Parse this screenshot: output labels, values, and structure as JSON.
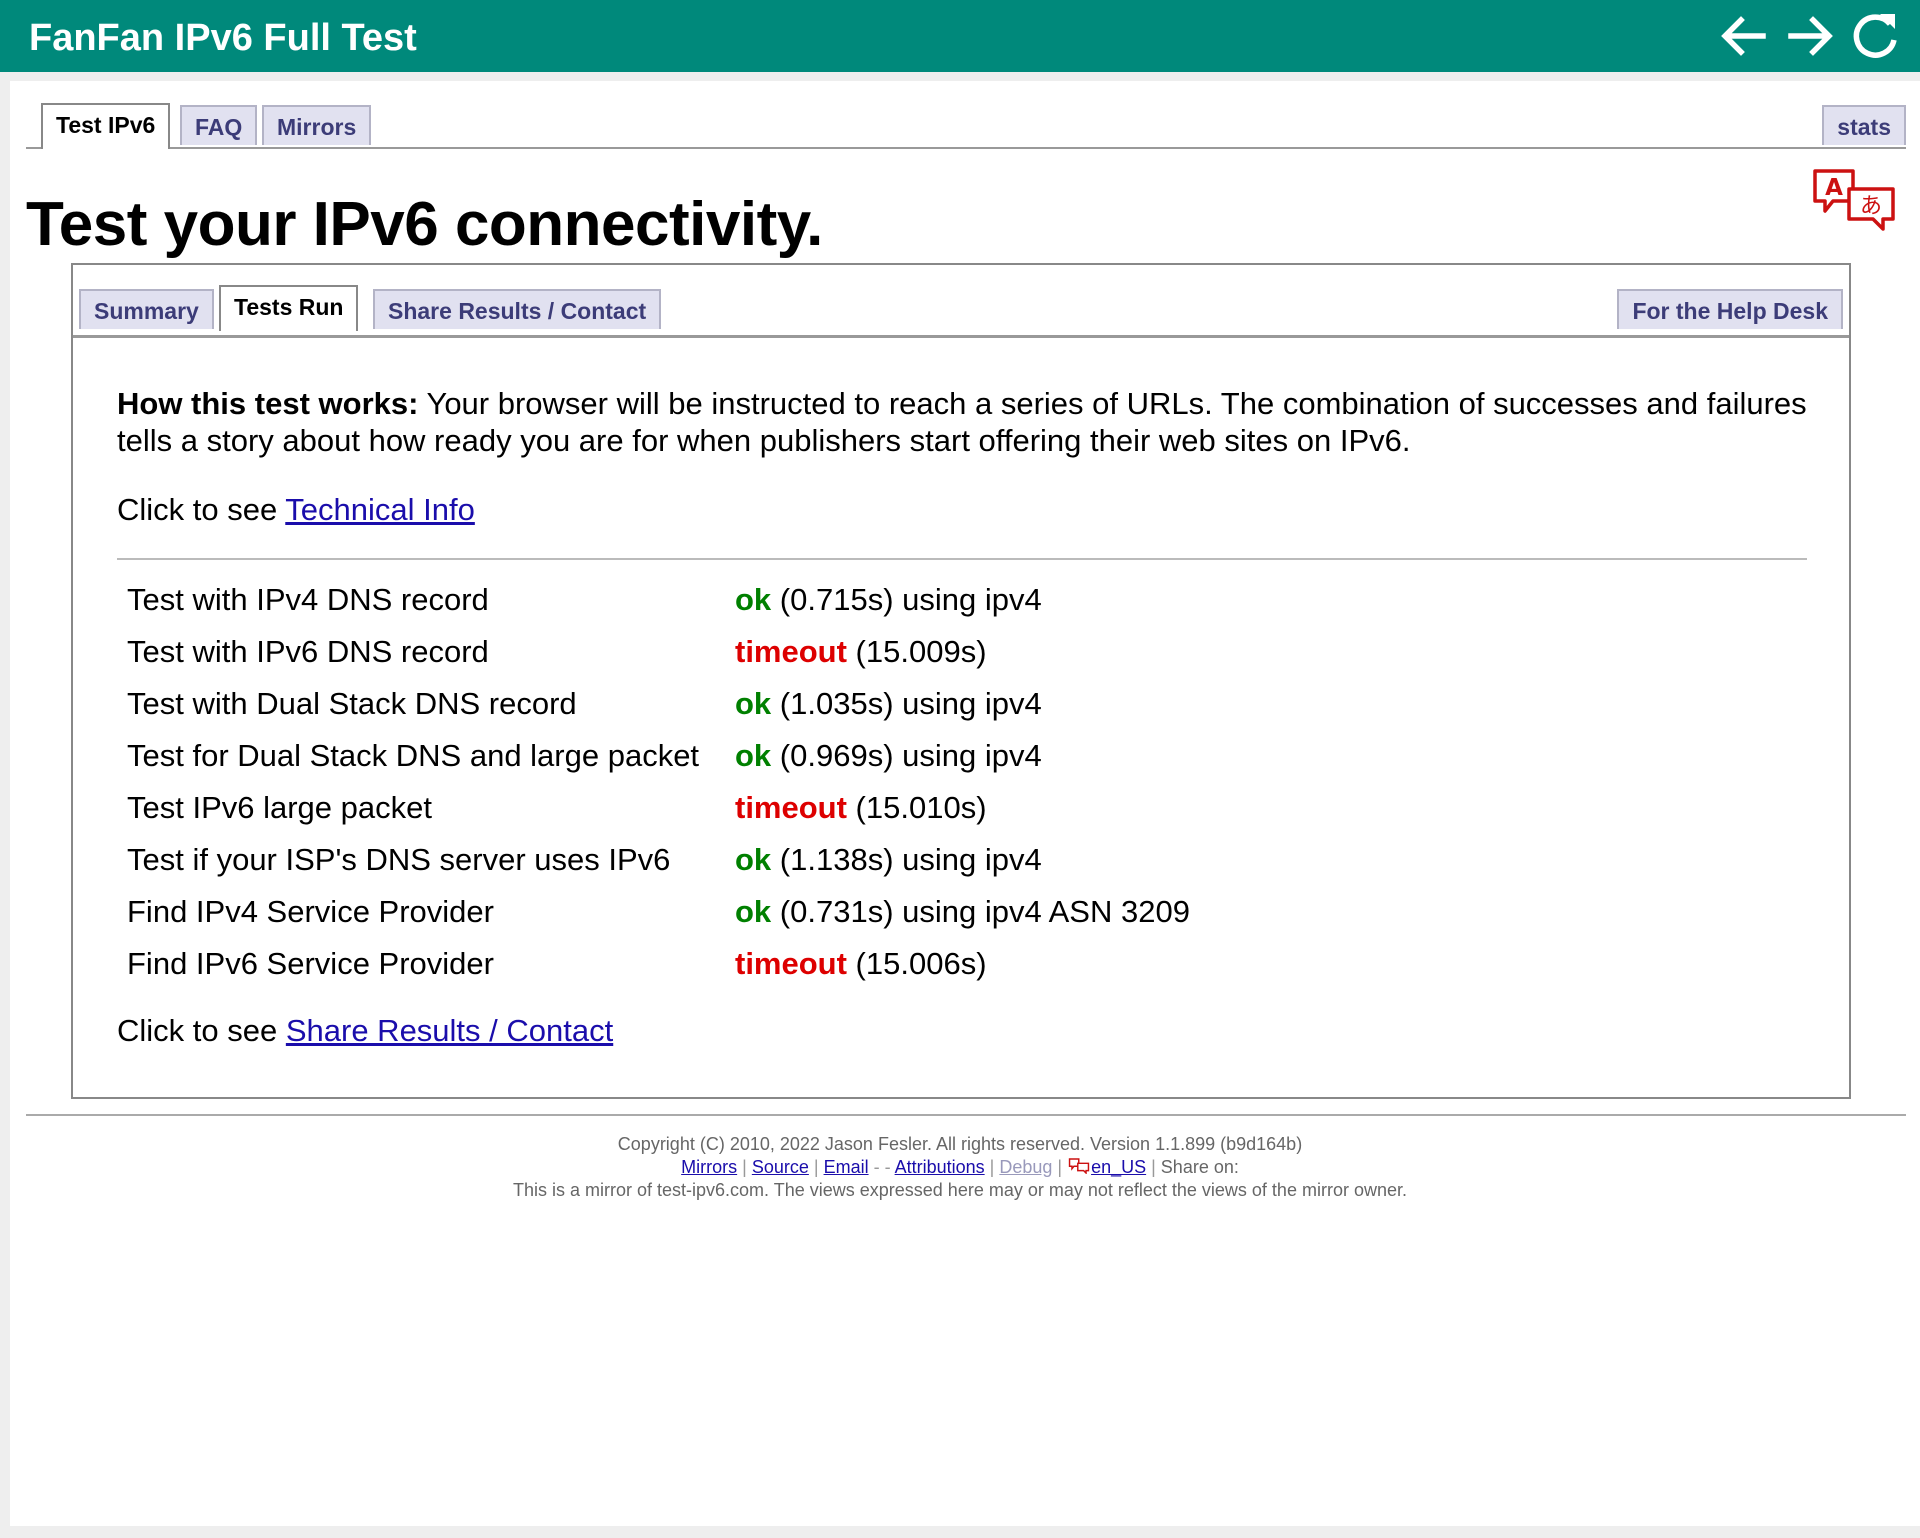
{
  "appbar": {
    "title": "FanFan IPv6 Full Test",
    "back_icon": "arrow-left-icon",
    "forward_icon": "arrow-right-icon",
    "reload_icon": "reload-icon",
    "color": "#00897b"
  },
  "top_tabs": {
    "test": "Test IPv6",
    "faq": "FAQ",
    "mirrors": "Mirrors",
    "stats": "stats",
    "active": "Test IPv6"
  },
  "heading": "Test your IPv6 connectivity.",
  "language_icon": "translate-icon",
  "sub_tabs": {
    "summary": "Summary",
    "tests_run": "Tests Run",
    "share": "Share Results / Contact",
    "helpdesk": "For the Help Desk",
    "active": "Tests Run"
  },
  "intro": {
    "bold": "How this test works:",
    "text": " Your browser will be instructed to reach a series of URLs. The combination of successes and failures tells a story about how ready you are for when publishers start offering their web sites on IPv6."
  },
  "technical": {
    "prefix": "Click to see ",
    "link": "Technical Info"
  },
  "results": [
    {
      "name": "Test with IPv4 DNS record",
      "status": "ok",
      "detail": " (0.715s) using ipv4"
    },
    {
      "name": "Test with IPv6 DNS record",
      "status": "timeout",
      "detail": " (15.009s)"
    },
    {
      "name": "Test with Dual Stack DNS record",
      "status": "ok",
      "detail": " (1.035s) using ipv4"
    },
    {
      "name": "Test for Dual Stack DNS and large packet",
      "status": "ok",
      "detail": " (0.969s) using ipv4"
    },
    {
      "name": "Test IPv6 large packet",
      "status": "timeout",
      "detail": " (15.010s)"
    },
    {
      "name": "Test if your ISP's DNS server uses IPv6",
      "status": "ok",
      "detail": " (1.138s) using ipv4"
    },
    {
      "name": "Find IPv4 Service Provider",
      "status": "ok",
      "detail": " (0.731s) using ipv4 ASN 3209"
    },
    {
      "name": "Find IPv6 Service Provider",
      "status": "timeout",
      "detail": " (15.006s)"
    }
  ],
  "status_colors": {
    "ok": "#008000",
    "timeout": "#dd0000"
  },
  "share": {
    "prefix": "Click to see ",
    "link": "Share Results / Contact"
  },
  "footer": {
    "copyright": "Copyright (C) 2010, 2022 Jason Fesler. All rights reserved. Version 1.1.899 (b9d164b)",
    "links": {
      "mirrors": "Mirrors",
      "source": "Source",
      "email": "Email",
      "attributions": "Attributions",
      "debug": "Debug",
      "locale": "en_US",
      "share_on": "Share on:"
    },
    "sep_pipe": " | ",
    "sep_dash": " - ",
    "sep_dash2": " - ",
    "mirror_note": "This is a mirror of test-ipv6.com. The views expressed here may or may not reflect the views of the mirror owner."
  }
}
